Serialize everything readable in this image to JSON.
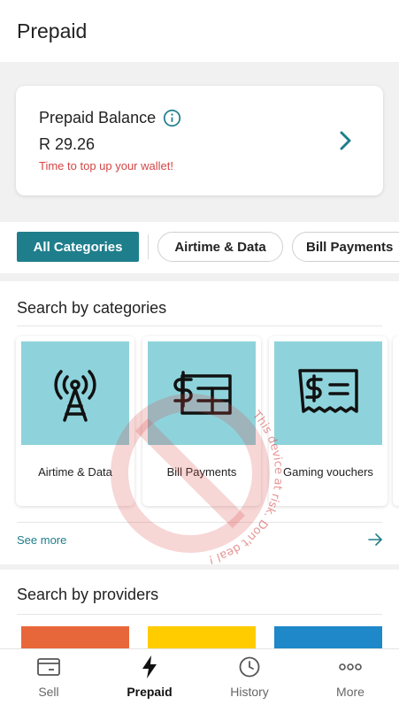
{
  "header": {
    "title": "Prepaid"
  },
  "balance": {
    "label": "Prepaid Balance",
    "amount": "R 29.26",
    "warning": "Time to top up your wallet!"
  },
  "chips": [
    {
      "label": "All Categories",
      "active": true
    },
    {
      "label": "Airtime & Data",
      "active": false
    },
    {
      "label": "Bill Payments",
      "active": false
    }
  ],
  "categories": {
    "title": "Search by categories",
    "items": [
      {
        "label": "Airtime & Data",
        "icon": "antenna-icon"
      },
      {
        "label": "Bill Payments",
        "icon": "bill-icon"
      },
      {
        "label": "Gaming vouchers",
        "icon": "voucher-icon"
      }
    ],
    "see_more": "See more"
  },
  "providers": {
    "title": "Search by providers",
    "colors": [
      "#e8673a",
      "#ffcc00",
      "#1e88c8"
    ]
  },
  "watermark": {
    "text": "This device at risk. Don't deal !"
  },
  "tabbar": {
    "items": [
      {
        "label": "Sell",
        "icon": "wallet-icon",
        "active": false
      },
      {
        "label": "Prepaid",
        "icon": "lightning-icon",
        "active": true
      },
      {
        "label": "History",
        "icon": "clock-icon",
        "active": false
      },
      {
        "label": "More",
        "icon": "more-dots-icon",
        "active": false
      }
    ]
  },
  "colors": {
    "accent": "#1f7e8c",
    "warning": "#d64545",
    "tile": "#8ed3db"
  }
}
